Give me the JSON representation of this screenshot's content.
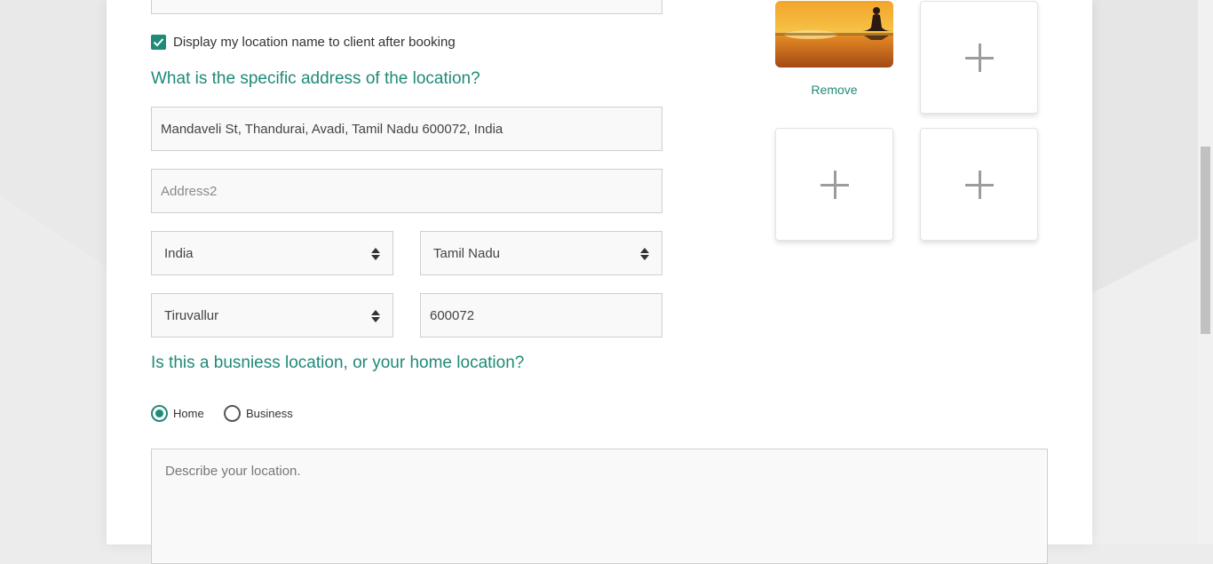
{
  "form": {
    "display_location_checkbox": {
      "label": "Display my location name to client after booking",
      "checked": true
    },
    "address_heading": "What is the specific address of the location?",
    "address1": {
      "value": "Mandaveli St, Thandurai, Avadi, Tamil Nadu 600072, India",
      "placeholder": ""
    },
    "address2": {
      "value": "",
      "placeholder": "Address2"
    },
    "country": {
      "selected": "India"
    },
    "state": {
      "selected": "Tamil Nadu"
    },
    "city": {
      "selected": "Tiruvallur"
    },
    "postal_code": {
      "value": "600072"
    },
    "location_type_heading": "Is this a busniess location, or your home location?",
    "location_type": {
      "options": [
        {
          "label": "Home",
          "checked": true
        },
        {
          "label": "Business",
          "checked": false
        }
      ]
    },
    "description": {
      "value": "",
      "placeholder": "Describe your location."
    }
  },
  "photos": {
    "remove_label": "Remove",
    "slots": [
      "photo",
      "empty",
      "empty",
      "empty"
    ]
  },
  "colors": {
    "accent": "#1f8a78",
    "field_background": "#f9f9f9",
    "field_border": "#cfcfcf",
    "page_background": "#ececec"
  },
  "icons": {
    "checkbox": "checkmark-icon",
    "select": "sort-arrows-icon",
    "add_photo": "plus-icon"
  }
}
